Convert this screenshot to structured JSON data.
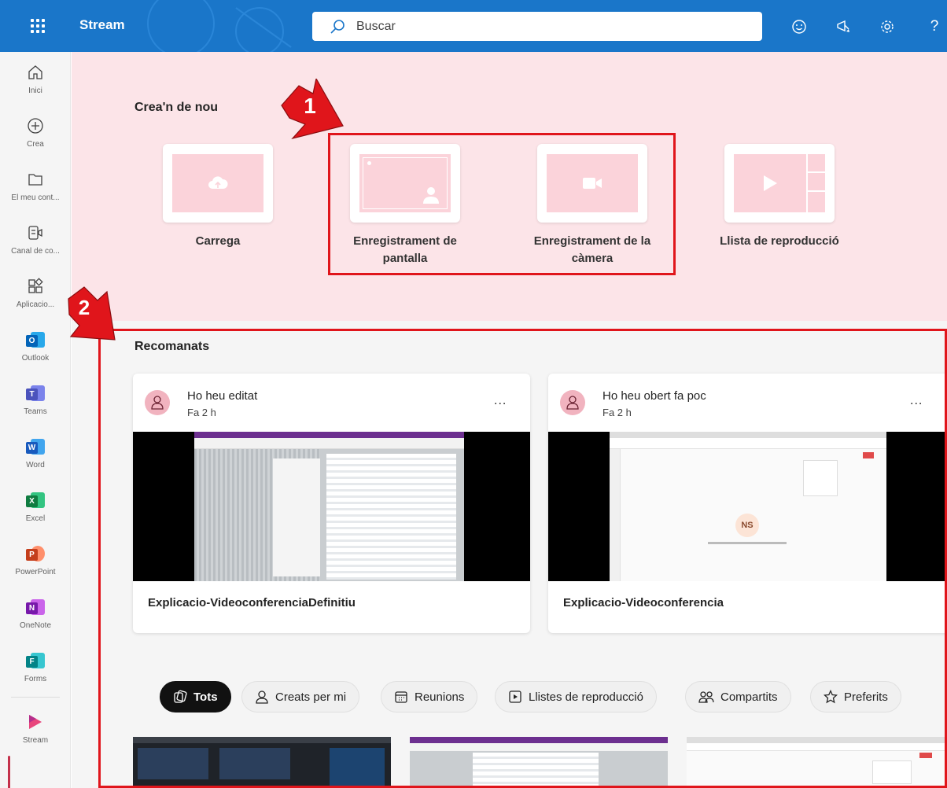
{
  "app": {
    "title": "Stream"
  },
  "search": {
    "placeholder": "Buscar"
  },
  "rail": {
    "items": [
      {
        "label": "Inici"
      },
      {
        "label": "Crea"
      },
      {
        "label": "El meu cont..."
      },
      {
        "label": "Canal de co..."
      },
      {
        "label": "Aplicacio..."
      },
      {
        "label": "Outlook",
        "letter": "O",
        "color": "#0364b8"
      },
      {
        "label": "Teams",
        "letter": "T",
        "color": "#4b53bc"
      },
      {
        "label": "Word",
        "letter": "W",
        "color": "#185abd"
      },
      {
        "label": "Excel",
        "letter": "X",
        "color": "#107c41"
      },
      {
        "label": "PowerPoint",
        "letter": "P",
        "color": "#c43e1c"
      },
      {
        "label": "OneNote",
        "letter": "N",
        "color": "#7719aa"
      },
      {
        "label": "Forms",
        "letter": "F",
        "color": "#038387"
      },
      {
        "label": "Stream"
      }
    ]
  },
  "create": {
    "title": "Crea'n de nou",
    "tiles": [
      {
        "label": "Carrega"
      },
      {
        "label": "Enregistrament de pantalla"
      },
      {
        "label": "Enregistrament de la càmera"
      },
      {
        "label": "Llista de reproducció"
      }
    ]
  },
  "recommended": {
    "title": "Recomanats",
    "cards": [
      {
        "title": "Ho heu editat",
        "time": "Fa 2 h",
        "more": "...",
        "video_title": "Explicacio-VideoconferenciaDefinitiu"
      },
      {
        "title": "Ho heu obert fa poc",
        "time": "Fa 2 h",
        "more": "...",
        "video_title": "Explicacio-Videoconferencia",
        "avatar_initials": "NS"
      }
    ]
  },
  "filters": [
    {
      "label": "Tots",
      "active": true
    },
    {
      "label": "Creats per mi"
    },
    {
      "label": "Reunions"
    },
    {
      "label": "Llistes de reproducció"
    },
    {
      "label": "Compartits"
    },
    {
      "label": "Preferits"
    }
  ],
  "annotations": [
    {
      "number": "1"
    },
    {
      "number": "2"
    }
  ],
  "colors": {
    "header": "#1a76c9",
    "create_bg": "#fce4e8",
    "accent": "#c4314b",
    "annotation": "#e0151b"
  }
}
